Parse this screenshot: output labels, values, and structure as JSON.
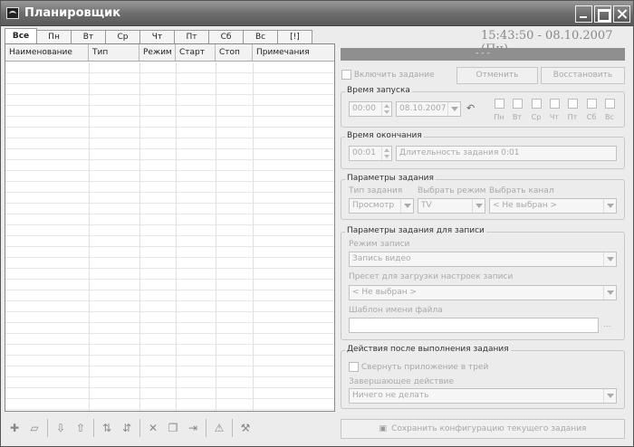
{
  "window": {
    "title": "Планировщик"
  },
  "tabs": [
    "Все",
    "Пн",
    "Вт",
    "Ср",
    "Чт",
    "Пт",
    "Сб",
    "Вс",
    "[!]"
  ],
  "clock": "15:43:50 - 08.10.2007 (Пн)",
  "table": {
    "columns": [
      "Наименование",
      "Тип",
      "Режим",
      "Старт",
      "Стоп",
      "Примечания"
    ]
  },
  "progress_text": "- - -",
  "top": {
    "enable_label": "Включить задание",
    "cancel_label": "Отменить",
    "restore_label": "Восстановить"
  },
  "start_time": {
    "title": "Время запуска",
    "time": "00:00",
    "date": "08.10.2007",
    "days": [
      "Пн",
      "Вт",
      "Ср",
      "Чт",
      "Пт",
      "Сб",
      "Вс"
    ]
  },
  "end_time": {
    "title": "Время окончания",
    "time": "00:01",
    "duration": "Длительность задания 0:01"
  },
  "task_params": {
    "title": "Параметры задания",
    "type_label": "Тип задания",
    "mode_label": "Выбрать режим",
    "channel_label": "Выбрать канал",
    "type_value": "Просмотр",
    "mode_value": "TV",
    "channel_value": "< Не выбран >"
  },
  "record_params": {
    "title": "Параметры задания для записи",
    "mode_label": "Режим записи",
    "mode_value": "Запись видео",
    "preset_label": "Пресет для загрузки настроек записи",
    "preset_value": "< Не выбран >",
    "template_label": "Шаблон имени файла",
    "template_value": "",
    "browse_label": "..."
  },
  "after_actions": {
    "title": "Действия после выполнения задания",
    "minimize_label": "Свернуть приложение в трей",
    "final_label": "Завершающее действие",
    "final_value": "Ничего не делать"
  },
  "save_label": "Сохранить конфигурацию текущего задания"
}
